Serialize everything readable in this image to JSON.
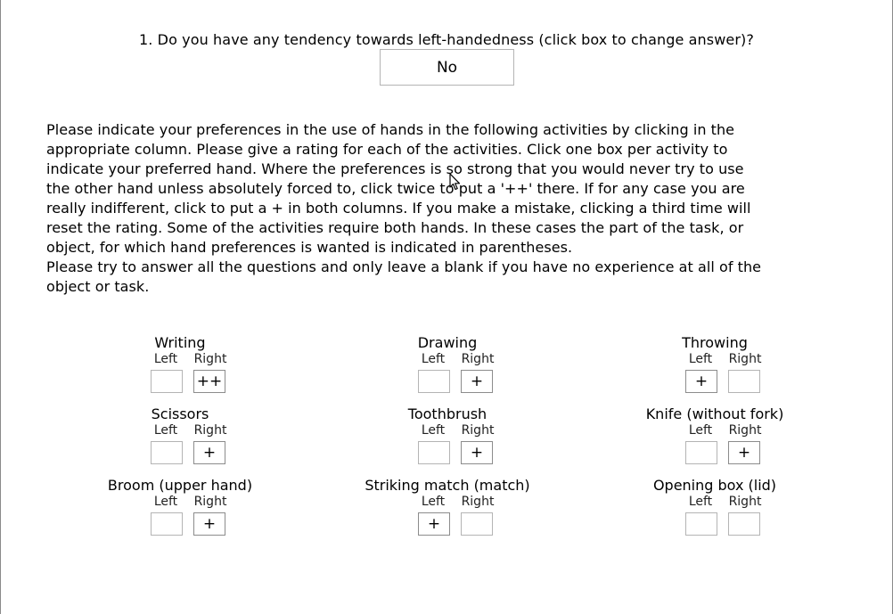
{
  "question": {
    "text": "1. Do you have any tendency towards left-handedness (click box to change answer)?",
    "answer": "No"
  },
  "instructions": [
    "Please indicate your preferences in the use of hands in the following activities by clicking in the",
    "appropriate column. Please give a rating for each of the activities.  Click one box per activity to",
    "indicate your preferred hand. Where the preferences is so strong that you would never try to use",
    "the other hand unless absolutely forced to, click twice to put a '++' there. If for any case you are",
    "really indifferent, click to put a + in both columns. If you make a mistake, clicking a third time will",
    "reset the rating.  Some of the activities require both hands. In these cases the part of the task, or",
    "object, for which hand preferences is wanted is indicated in parentheses.",
    "Please try to answer all the questions and only leave a blank if you have no experience at all of the",
    "object or task."
  ],
  "column_labels": {
    "left": "Left",
    "right": "Right"
  },
  "activities": [
    {
      "title": "Writing",
      "left": "",
      "right": "++"
    },
    {
      "title": "Drawing",
      "left": "",
      "right": "+"
    },
    {
      "title": "Throwing",
      "left": "+",
      "right": ""
    },
    {
      "title": "Scissors",
      "left": "",
      "right": "+"
    },
    {
      "title": "Toothbrush",
      "left": "",
      "right": "+"
    },
    {
      "title": "Knife (without fork)",
      "left": "",
      "right": "+"
    },
    {
      "title": "Broom (upper hand)",
      "left": "",
      "right": "+"
    },
    {
      "title": "Striking match (match)",
      "left": "+",
      "right": ""
    },
    {
      "title": "Opening box (lid)",
      "left": "",
      "right": ""
    }
  ]
}
